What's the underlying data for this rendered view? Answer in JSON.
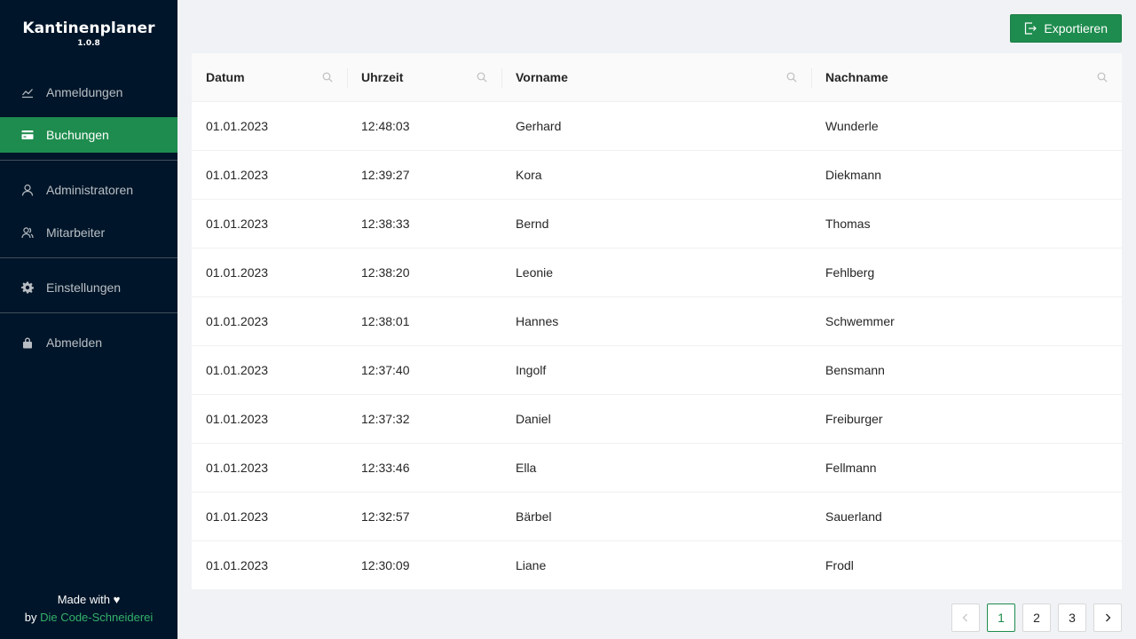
{
  "app": {
    "title": "Kantinenplaner",
    "version": "1.0.8"
  },
  "sidebar": {
    "items": [
      {
        "label": "Anmeldungen",
        "icon": "line-chart-icon"
      },
      {
        "label": "Buchungen",
        "icon": "credit-card-icon",
        "active": true
      },
      {
        "label": "Administratoren",
        "icon": "user-icon"
      },
      {
        "label": "Mitarbeiter",
        "icon": "team-icon"
      },
      {
        "label": "Einstellungen",
        "icon": "gear-icon"
      },
      {
        "label": "Abmelden",
        "icon": "lock-icon"
      }
    ],
    "footer": {
      "made_with": "Made with",
      "by": "by",
      "company": "Die Code-Schneiderei"
    }
  },
  "toolbar": {
    "export_label": "Exportieren"
  },
  "table": {
    "columns": [
      "Datum",
      "Uhrzeit",
      "Vorname",
      "Nachname"
    ],
    "rows": [
      [
        "01.01.2023",
        "12:48:03",
        "Gerhard",
        "Wunderle"
      ],
      [
        "01.01.2023",
        "12:39:27",
        "Kora",
        "Diekmann"
      ],
      [
        "01.01.2023",
        "12:38:33",
        "Bernd",
        "Thomas"
      ],
      [
        "01.01.2023",
        "12:38:20",
        "Leonie",
        "Fehlberg"
      ],
      [
        "01.01.2023",
        "12:38:01",
        "Hannes",
        "Schwemmer"
      ],
      [
        "01.01.2023",
        "12:37:40",
        "Ingolf",
        "Bensmann"
      ],
      [
        "01.01.2023",
        "12:37:32",
        "Daniel",
        "Freiburger"
      ],
      [
        "01.01.2023",
        "12:33:46",
        "Ella",
        "Fellmann"
      ],
      [
        "01.01.2023",
        "12:32:57",
        "Bärbel",
        "Sauerland"
      ],
      [
        "01.01.2023",
        "12:30:09",
        "Liane",
        "Frodl"
      ]
    ]
  },
  "pagination": {
    "pages": [
      "1",
      "2",
      "3"
    ],
    "current": "1"
  },
  "colors": {
    "sidebar_bg": "#001529",
    "accent": "#1e8c4e",
    "page_bg": "#f0f2f5"
  }
}
